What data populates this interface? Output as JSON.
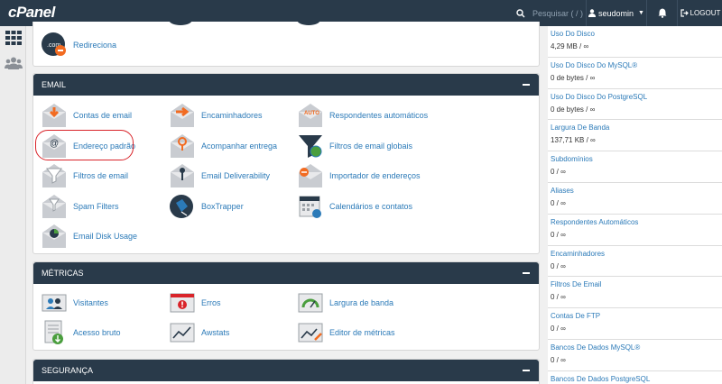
{
  "topbar": {
    "logo": "cPanel",
    "search_placeholder": "Pesquisar ( / )",
    "username": "seudomin",
    "logout_label": "LOGOUT"
  },
  "domains_partial": {
    "redirect_label": "Redireciona"
  },
  "email_panel": {
    "title": "EMAIL",
    "items": [
      "Contas de email",
      "Encaminhadores",
      "Respondentes automáticos",
      "Endereço padrão",
      "Acompanhar entrega",
      "Filtros de email globais",
      "Filtros de email",
      "Email Deliverability",
      "Importador de endereços",
      "Spam Filters",
      "BoxTrapper",
      "Calendários e contatos",
      "Email Disk Usage"
    ]
  },
  "metrics_panel": {
    "title": "MÉTRICAS",
    "items": [
      "Visitantes",
      "Erros",
      "Largura de banda",
      "Acesso bruto",
      "Awstats",
      "Editor de métricas"
    ]
  },
  "security_panel": {
    "title": "SEGURANÇA"
  },
  "stats": [
    {
      "label": "Uso Do Disco",
      "value": "4,29 MB / ∞"
    },
    {
      "label": "Uso Do Disco Do MySQL®",
      "value": "0 de bytes / ∞"
    },
    {
      "label": "Uso Do Disco Do PostgreSQL",
      "value": "0 de bytes / ∞"
    },
    {
      "label": "Largura De Banda",
      "value": "137,71 KB / ∞"
    },
    {
      "label": "Subdomínios",
      "value": "0 / ∞"
    },
    {
      "label": "Aliases",
      "value": "0 / ∞"
    },
    {
      "label": "Respondentes Automáticos",
      "value": "0 / ∞"
    },
    {
      "label": "Encaminhadores",
      "value": "0 / ∞"
    },
    {
      "label": "Filtros De Email",
      "value": "0 / ∞"
    },
    {
      "label": "Contas De FTP",
      "value": "0 / ∞"
    },
    {
      "label": "Bancos De Dados MySQL®",
      "value": "0 / ∞"
    },
    {
      "label": "Bancos De Dados PostgreSQL",
      "value": ""
    }
  ],
  "colors": {
    "header": "#293a4a",
    "link": "#2b7ab8",
    "highlight": "#d9242a",
    "accent_orange": "#f26b21"
  }
}
